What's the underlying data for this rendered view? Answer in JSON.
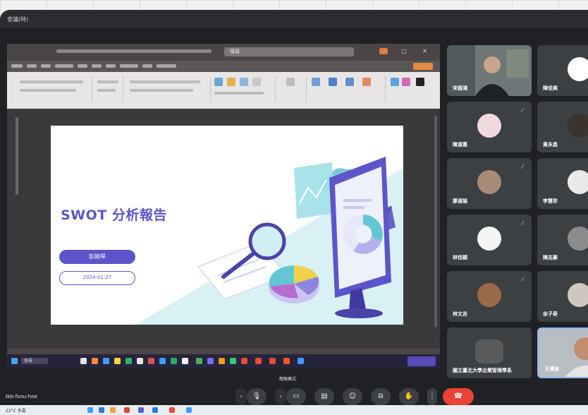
{
  "window": {
    "title": "會議(時)"
  },
  "presentation": {
    "search_placeholder": "搜尋",
    "slide": {
      "title": "SWOT 分析報告",
      "presenter_name": "彭婉琴",
      "date": "2024-01-27"
    },
    "taskbar_search": "搜尋"
  },
  "participants": [
    {
      "name": "宋振鴻",
      "type": "video"
    },
    {
      "name": "陳佳美",
      "type": "avatar"
    },
    {
      "name": "黃永昌",
      "type": "avatar"
    },
    {
      "name": "陳淑惠",
      "type": "avatar"
    },
    {
      "name": "廖淑娟",
      "type": "avatar"
    },
    {
      "name": "李慧珍",
      "type": "avatar"
    },
    {
      "name": "林佳穎",
      "type": "avatar"
    },
    {
      "name": "陳志豪",
      "type": "avatar"
    },
    {
      "name": "蔡昆志",
      "type": "avatar"
    },
    {
      "name": "林文吉",
      "type": "avatar"
    },
    {
      "name": "余子奇",
      "type": "avatar"
    },
    {
      "name": "國立臺北大學企業管理學系",
      "type": "avatar"
    },
    {
      "name": "王博崇",
      "type": "video"
    }
  ],
  "controls": {
    "label": "簡報模式",
    "meeting_code": "tkb-fxnu-hne",
    "mic_icon": "mic-icon",
    "camera_icon": "camera-icon",
    "captions_icon": "captions-icon",
    "emoji_icon": "emoji-icon",
    "present_icon": "present-icon",
    "hand_icon": "raise-hand-icon",
    "more_icon": "more-icon",
    "end_icon": "end-call-icon"
  },
  "os_taskbar": {
    "text": "22°C 多雲"
  },
  "colors": {
    "accent_purple": "#5b55c9",
    "end_call": "#ea4335",
    "meet_bg": "#202124",
    "tile_bg": "#3c4043"
  }
}
